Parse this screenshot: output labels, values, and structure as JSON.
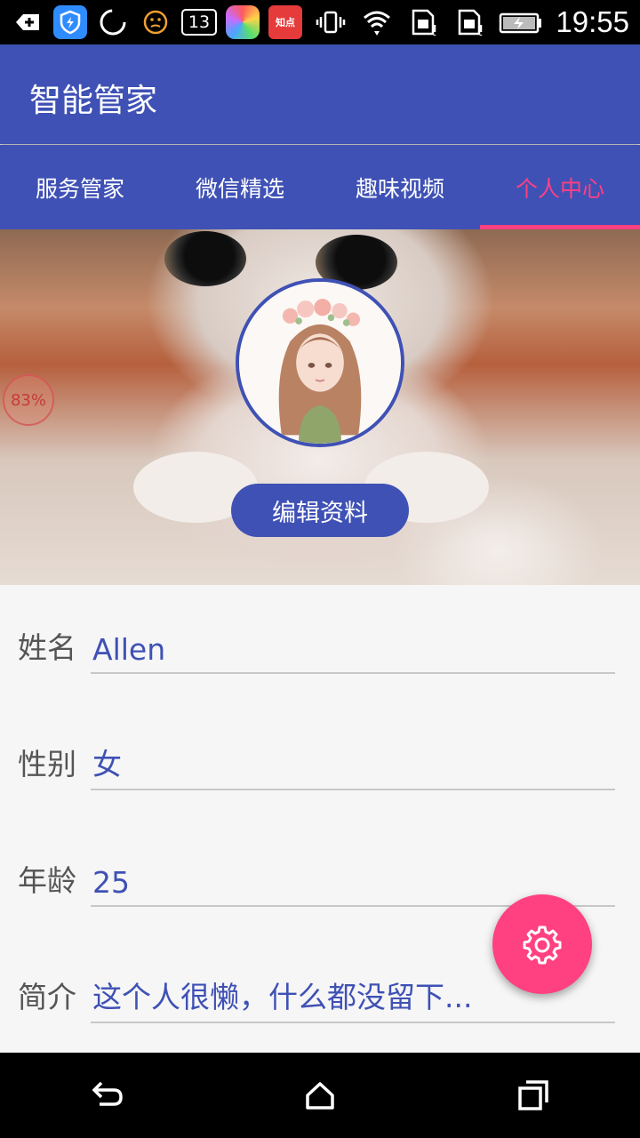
{
  "status_bar": {
    "time": "19:55",
    "notification_count": "13",
    "app_badge_text": "知点",
    "icons": [
      "add-icon",
      "shield-app-icon",
      "loading-ring-icon",
      "face-icon",
      "count-badge",
      "rainbow-app-icon",
      "red-app-icon",
      "vibrate-icon",
      "wifi-icon",
      "sim1-icon",
      "sim2-icon",
      "battery-charging-icon"
    ]
  },
  "app_bar": {
    "title": "智能管家",
    "color": "#3f51b5"
  },
  "tabs": [
    {
      "label": "服务管家",
      "active": false
    },
    {
      "label": "微信精选",
      "active": false
    },
    {
      "label": "趣味视频",
      "active": false
    },
    {
      "label": "个人中心",
      "active": true
    }
  ],
  "accent_color": "#ff4081",
  "header": {
    "progress_text": "83%",
    "edit_button_label": "编辑资料"
  },
  "profile": {
    "name_label": "姓名",
    "name_value": "Allen",
    "gender_label": "性别",
    "gender_value": "女",
    "age_label": "年龄",
    "age_value": "25",
    "bio_label": "简介",
    "bio_value": "这个人很懒，什么都没留下..."
  },
  "fab": {
    "icon": "gear-icon"
  },
  "nav_bar": {
    "icons": [
      "back-icon",
      "home-icon",
      "recents-icon"
    ]
  }
}
